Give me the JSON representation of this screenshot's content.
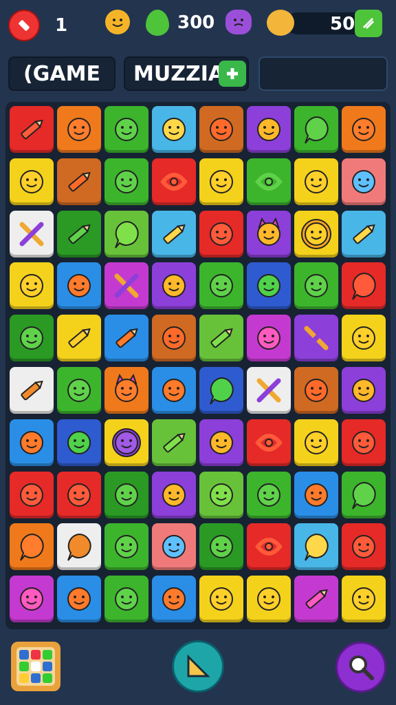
{
  "hud": {
    "lives_icon": "eraser-icon",
    "lives_count": "1",
    "gem_count": "300",
    "coin_count": "50"
  },
  "panels": {
    "left_label": "(GAME",
    "middle_label": "MUZZIA",
    "plus_icon": "plus-icon"
  },
  "colors": {
    "background": "#23344f",
    "board": "#172233"
  },
  "board": {
    "rows": [
      [
        "red:pencil",
        "orange:smiley",
        "green:smiley",
        "sky:smiley",
        "brown:smiley",
        "purple:smiley",
        "green:bubble",
        "orange:smiley"
      ],
      [
        "yellow:smiley",
        "brown:pencil",
        "green:smiley",
        "red:swirl",
        "yellow:smiley",
        "green:swirl",
        "yellow:smiley",
        "pink:smiley"
      ],
      [
        "white:cross",
        "dgreen:pencil",
        "lgreen:bubble",
        "sky:pencil",
        "red:smiley",
        "purple:cat",
        "yellow:lion",
        "sky:pencil"
      ],
      [
        "yellow:smiley",
        "blue:smiley",
        "magenta:cross",
        "purple:smiley",
        "green:smiley",
        "navy:smiley",
        "green:smiley",
        "red:bubble"
      ],
      [
        "dgreen:smiley",
        "yellow:pencil",
        "blue:pencil",
        "brown:smiley",
        "lgreen:pencil",
        "magenta:smiley",
        "purple:cross",
        "yellow:smiley"
      ],
      [
        "white:pencil",
        "green:smiley",
        "orange:cat",
        "blue:smiley",
        "navy:bubble",
        "white:cross",
        "brown:smiley",
        "purple:smiley"
      ],
      [
        "blue:smiley",
        "navy:smiley",
        "yellow:blob",
        "lgreen:pencil",
        "purple:smiley",
        "red:swirl",
        "yellow:smiley",
        "red:smiley"
      ],
      [
        "red:smiley",
        "red:smiley",
        "dgreen:smiley",
        "purple:smiley",
        "lgreen:smiley",
        "green:smiley",
        "blue:smiley",
        "green:bubble"
      ],
      [
        "orange:bubble",
        "white:bubble",
        "green:smiley",
        "pink:smiley",
        "dgreen:smiley",
        "red:swirl",
        "sky:bubble",
        "red:smiley"
      ],
      [
        "magenta:smiley",
        "blue:smiley",
        "green:smiley",
        "blue:smiley",
        "yellow:smiley",
        "yellow:smiley",
        "magenta:pencil",
        "yellow:smiley"
      ]
    ]
  },
  "bottom_bar": {
    "left_icon": "level-grid-icon",
    "center_icon": "play-triangle-icon",
    "right_icon": "magnifier-icon"
  }
}
